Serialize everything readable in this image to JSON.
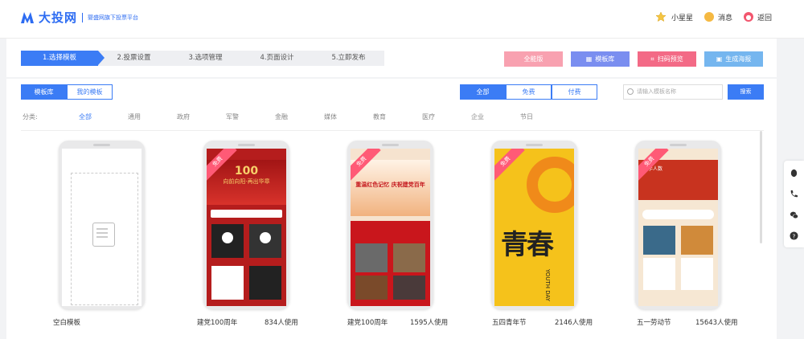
{
  "app": {
    "logo_text": "大投网",
    "logo_sub": "婴盛网旗下投票平台",
    "brand_color": "#2d6cf2"
  },
  "user": {
    "name": "小星星",
    "message": "消息",
    "back": "返回"
  },
  "steps": [
    "1.选择模板",
    "2.投票设置",
    "3.选项管理",
    "4.页面设计",
    "5.立即发布"
  ],
  "actions": [
    {
      "label": "全能版",
      "icon": "",
      "color": "#f8a1b0"
    },
    {
      "label": "模板库",
      "icon": "grid-icon",
      "color": "#7a8ef0"
    },
    {
      "label": "扫码预览",
      "icon": "qr-icon",
      "color": "#f36a86"
    },
    {
      "label": "生成海报",
      "icon": "image-icon",
      "color": "#75b6ef"
    }
  ],
  "library_tabs": [
    "模板库",
    "我的模板"
  ],
  "price_tabs": [
    "全部",
    "免费",
    "付费"
  ],
  "search": {
    "placeholder": "请输入模板名称",
    "button": "搜索"
  },
  "categories": {
    "label": "分类:",
    "items": [
      "全部",
      "通用",
      "政府",
      "军警",
      "金融",
      "媒体",
      "教育",
      "医疗",
      "企业",
      "节日"
    ]
  },
  "templates": [
    {
      "name": "空白模板",
      "uses": "",
      "free": ""
    },
    {
      "name": "建党100周年",
      "uses": "834人使用",
      "free": "免费",
      "screen_title": "100",
      "screen_text": "向前向阳·再出华章"
    },
    {
      "name": "建党100周年",
      "uses": "1595人使用",
      "free": "免费",
      "screen_title": "重温红色记忆 庆祝建党百年"
    },
    {
      "name": "五四青年节",
      "uses": "2146人使用",
      "free": "免费",
      "screen_title": "青春",
      "screen_text": "YOUTH DAY"
    },
    {
      "name": "五一劳动节",
      "uses": "15643人使用",
      "free": "免费",
      "screen_title": "选手人数"
    }
  ]
}
